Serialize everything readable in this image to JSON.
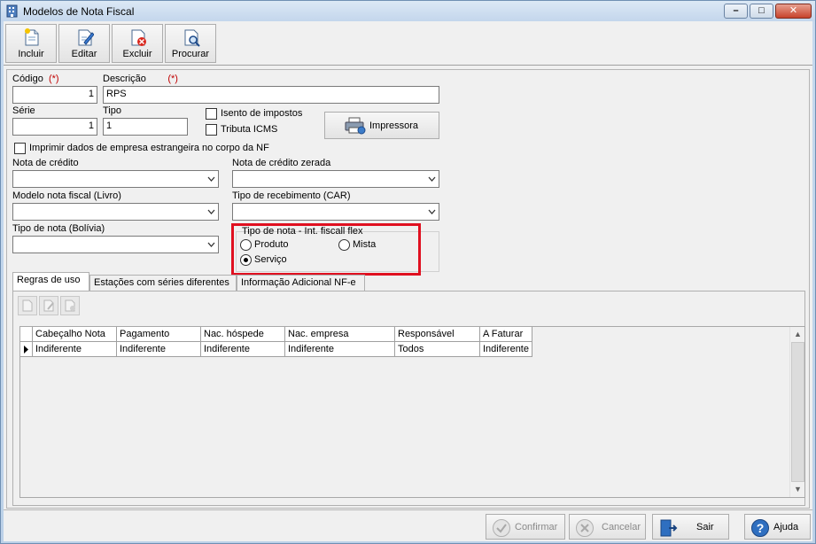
{
  "window": {
    "title": "Modelos de Nota Fiscal",
    "minimize": "–",
    "maximize": "□",
    "close": "✕"
  },
  "toolbar": {
    "incluir": "Incluir",
    "editar": "Editar",
    "excluir": "Excluir",
    "procurar": "Procurar"
  },
  "form": {
    "codigo_label": "Código",
    "codigo_req": "(*)",
    "codigo_value": "1",
    "descricao_label": "Descrição",
    "descricao_req": "(*)",
    "descricao_value": "RPS",
    "serie_label": "Série",
    "serie_value": "1",
    "tipo_label": "Tipo",
    "tipo_value": "1",
    "isento_label": "Isento de impostos",
    "tributa_label": "Tributa ICMS",
    "impressora_label": "Impressora",
    "imprimir_label": "Imprimir dados de empresa estrangeira no corpo da NF",
    "nota_credito_label": "Nota de crédito",
    "nota_credito_zerada_label": "Nota de crédito zerada",
    "modelo_livro_label": "Modelo nota fiscal (Livro)",
    "tipo_recebimento_label": "Tipo de recebimento (CAR)",
    "tipo_bolivia_label": "Tipo de nota (Bolívia)",
    "tipo_nota_int_label": "Tipo de nota - Int. fiscall flex",
    "opt_produto": "Produto",
    "opt_mista": "Mista",
    "opt_servico": "Serviço",
    "selected_option": "Serviço"
  },
  "tabs": {
    "regras": "Regras de uso",
    "estacoes": "Estações com séries diferentes",
    "info": "Informação Adicional NF-e"
  },
  "grid": {
    "headers": [
      "Cabeçalho Nota",
      "Pagamento",
      "Nac. hóspede",
      "Nac. empresa",
      "Responsável",
      "A Faturar"
    ],
    "rows": [
      [
        "Indiferente",
        "Indiferente",
        "Indiferente",
        "Indiferente",
        "Todos",
        "Indiferente"
      ]
    ]
  },
  "bottom": {
    "confirmar": "Confirmar",
    "cancelar": "Cancelar",
    "sair": "Sair",
    "ajuda": "Ajuda"
  }
}
